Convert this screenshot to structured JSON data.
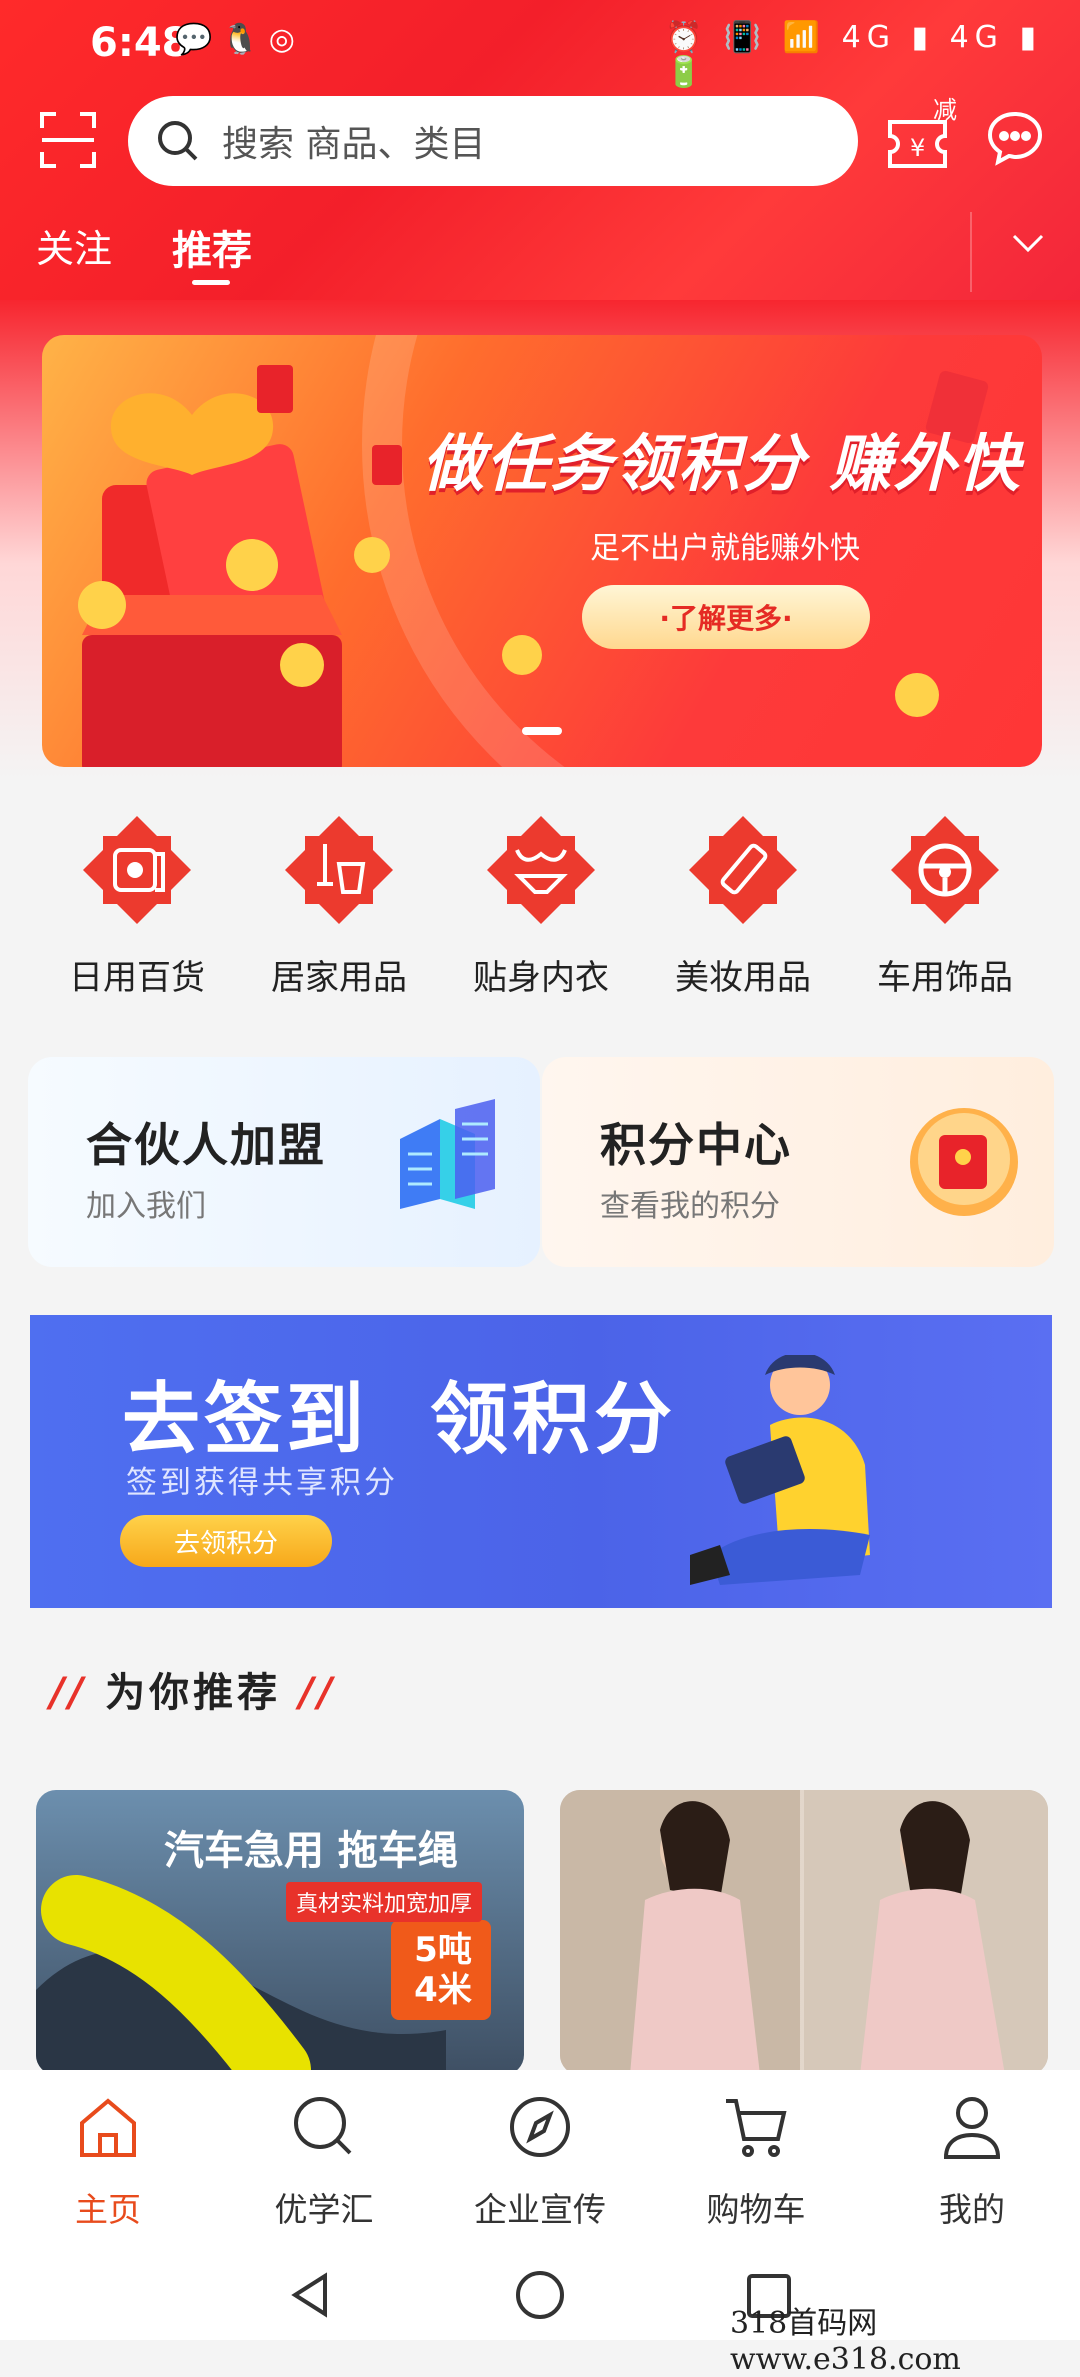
{
  "status": {
    "time": "6:48",
    "left_icons": "💬 🐧 ◎",
    "right_icons": "⏰ 📳 📶 4G ▮ 4G ▮ 🔋"
  },
  "search": {
    "placeholder": "搜索 商品、类目"
  },
  "coupon": {
    "badge": "减"
  },
  "tabs": [
    {
      "label": "关注"
    },
    {
      "label": "推荐"
    }
  ],
  "banner": {
    "headline": "做任务领积分 赚外快",
    "subtitle": "足不出户就能赚外快",
    "button": "·了解更多·"
  },
  "categories": [
    {
      "label": "日用百货",
      "icon": "tissue-roll-icon"
    },
    {
      "label": "居家用品",
      "icon": "mop-bucket-icon"
    },
    {
      "label": "贴身内衣",
      "icon": "lingerie-icon"
    },
    {
      "label": "美妆用品",
      "icon": "lipstick-icon"
    },
    {
      "label": "车用饰品",
      "icon": "steering-wheel-icon"
    }
  ],
  "cards": {
    "partner": {
      "title": "合伙人加盟",
      "subtitle": "加入我们"
    },
    "points": {
      "title": "积分中心",
      "subtitle": "查看我的积分"
    }
  },
  "sign": {
    "title_a": "去签到",
    "title_b": "领积分",
    "subtitle": "签到获得共享积分",
    "button": "去领积分"
  },
  "recommend": {
    "heading": "为你推荐"
  },
  "products": [
    {
      "title": "汽车急用 拖车绳",
      "tag": "真材实料加宽加厚",
      "spec": "5吨\n4米"
    }
  ],
  "nav": [
    {
      "label": "主页",
      "icon": "home-icon",
      "active": true
    },
    {
      "label": "优学汇",
      "icon": "search-circle-icon",
      "active": false
    },
    {
      "label": "企业宣传",
      "icon": "compass-icon",
      "active": false
    },
    {
      "label": "购物车",
      "icon": "cart-icon",
      "active": false
    },
    {
      "label": "我的",
      "icon": "user-icon",
      "active": false
    }
  ],
  "watermark": "318首码网 www.e318.com",
  "colors": {
    "accent": "#e84b1c",
    "header_red": "#f7262f"
  }
}
